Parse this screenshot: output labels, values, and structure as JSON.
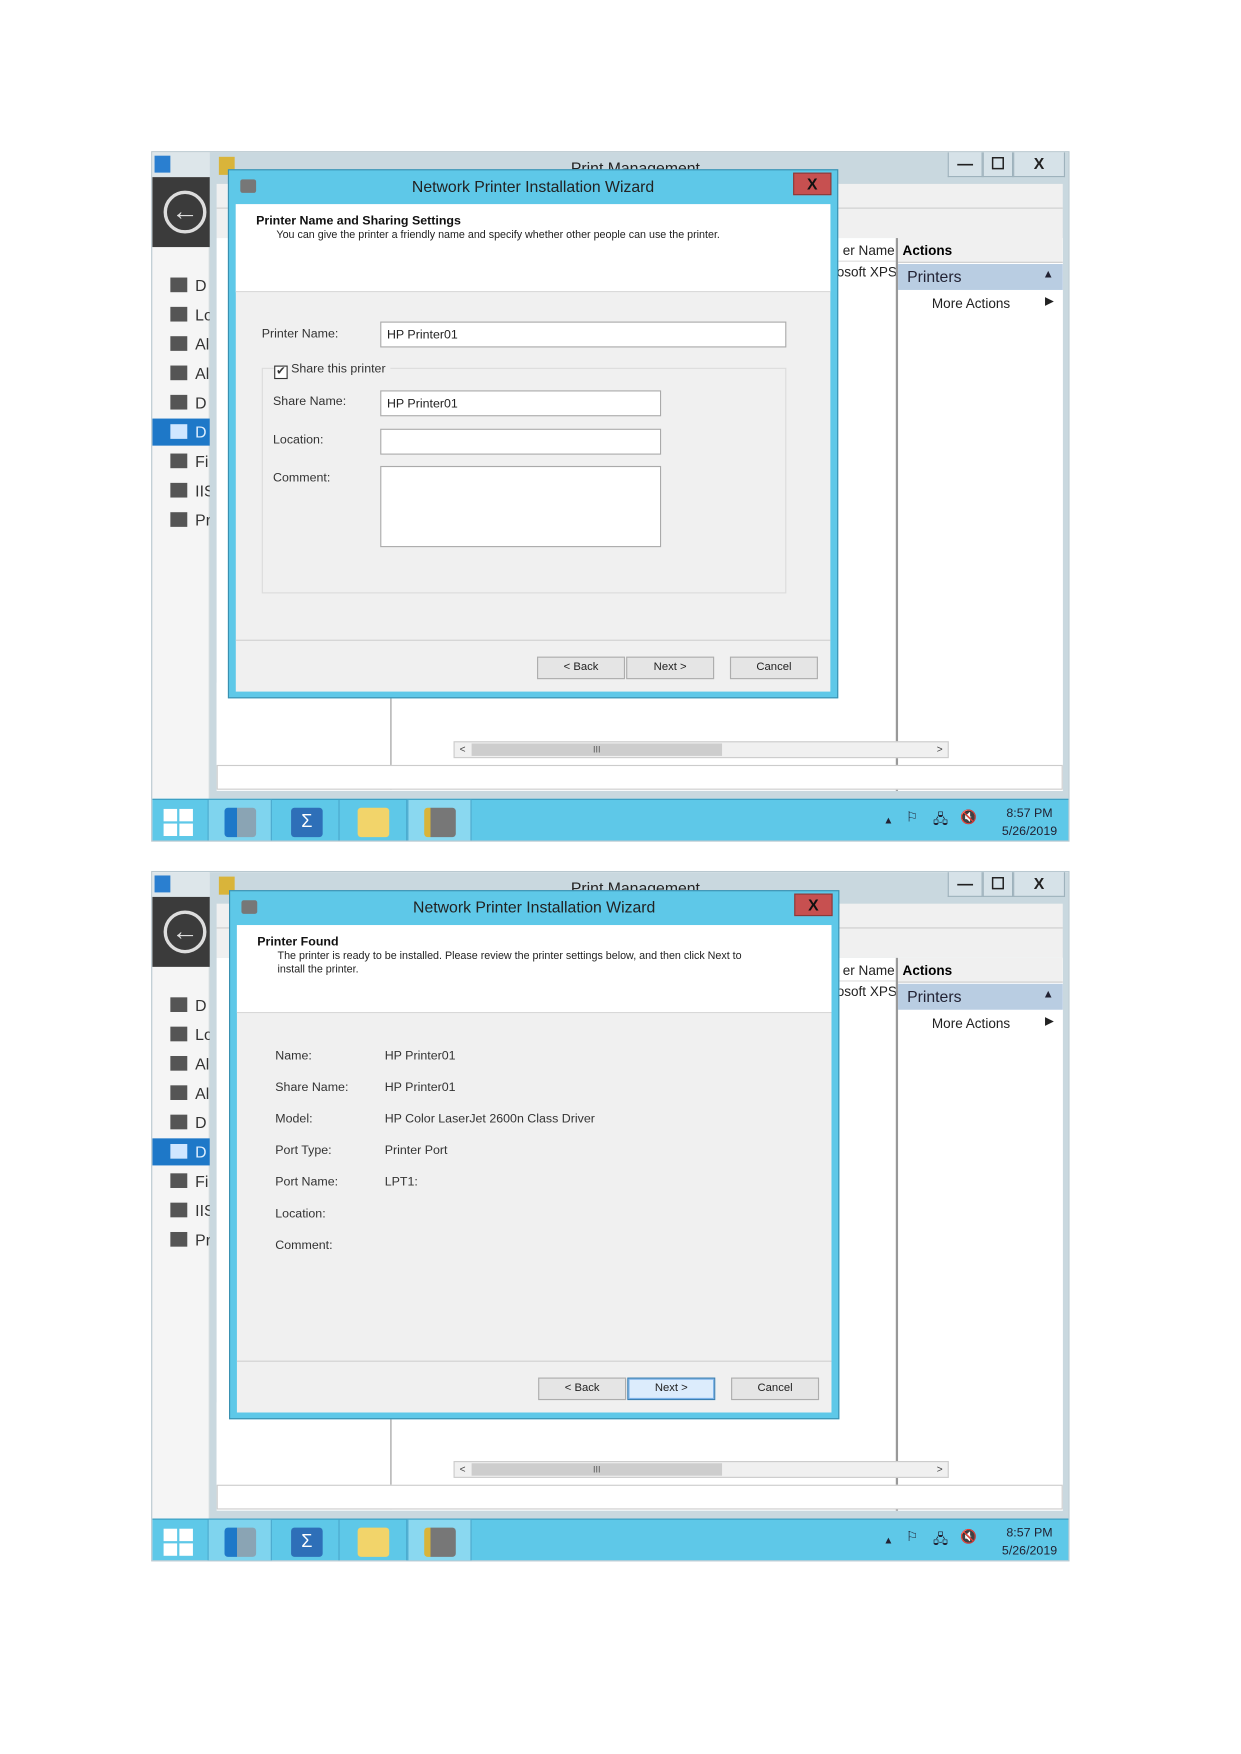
{
  "shell": {
    "window_title": "Print Management",
    "minimize": "—",
    "maximize": "☐",
    "close": "X",
    "back_icon": "←",
    "nav_items": [
      {
        "label": "D",
        "icon": "dashboard-icon"
      },
      {
        "label": "Lo",
        "icon": "local-server-icon"
      },
      {
        "label": "Al",
        "icon": "all-servers-icon"
      },
      {
        "label": "Al",
        "icon": "all-servers-icon"
      },
      {
        "label": "D",
        "icon": "dhcp-icon"
      },
      {
        "label": "D",
        "icon": "dns-icon",
        "selected": true
      },
      {
        "label": "Fi",
        "icon": "file-services-icon"
      },
      {
        "label": "IIS",
        "icon": "iis-icon"
      },
      {
        "label": "Pr",
        "icon": "print-services-icon"
      }
    ],
    "column_header": "er Name",
    "column_value": "osoft XPS",
    "actions": {
      "header": "Actions",
      "section": "Printers",
      "more": "More Actions"
    },
    "scroll_thumb": "III",
    "scroll_left": "<",
    "scroll_right": ">",
    "tray_arrow": "▲",
    "clock": {
      "time": "8:57 PM",
      "date": "5/26/2019"
    },
    "taskbar": [
      "start-icon",
      "server-manager-icon",
      "powershell-icon",
      "file-explorer-icon",
      "print-management-icon"
    ],
    "colors": {
      "taskbar": "#5ec8e8",
      "dialog_frame": "#5ec8e8",
      "close": "#c75050",
      "selected_nav": "#1e78c8"
    }
  },
  "dialog": {
    "title": "Network Printer Installation Wizard",
    "close": "X",
    "back": "< Back",
    "next": "Next >",
    "cancel": "Cancel"
  },
  "step1": {
    "heading": "Printer Name and Sharing Settings",
    "subtitle": "You can give the printer a friendly name and specify whether other people can use the printer.",
    "printer_name_label": "Printer Name:",
    "printer_name_value": "HP Printer01",
    "share_checkbox": "Share this printer",
    "share_checked": true,
    "share_name_label": "Share Name:",
    "share_name_value": "HP Printer01",
    "location_label": "Location:",
    "location_value": "",
    "comment_label": "Comment:",
    "comment_value": ""
  },
  "step2": {
    "heading": "Printer Found",
    "subtitle": "The printer is ready to be installed. Please review the printer settings below, and then click Next to install the printer.",
    "rows": [
      {
        "label": "Name:",
        "value": "HP Printer01"
      },
      {
        "label": "Share Name:",
        "value": "HP Printer01"
      },
      {
        "label": "Model:",
        "value": "HP Color LaserJet 2600n Class Driver"
      },
      {
        "label": "Port Type:",
        "value": "Printer Port"
      },
      {
        "label": "Port Name:",
        "value": "LPT1:"
      },
      {
        "label": "Location:",
        "value": ""
      },
      {
        "label": "Comment:",
        "value": ""
      }
    ]
  }
}
